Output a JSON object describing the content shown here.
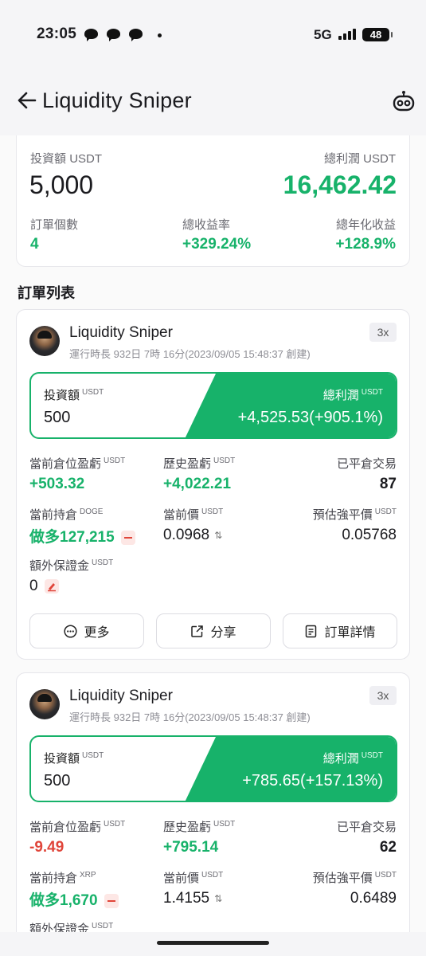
{
  "status_bar": {
    "time": "23:05",
    "network": "5G",
    "battery": "48"
  },
  "header": {
    "title": "Liquidity Sniper"
  },
  "summary": {
    "investment_label": "投資額",
    "investment_unit": "USDT",
    "investment_value": "5,000",
    "profit_label": "總利潤",
    "profit_unit": "USDT",
    "profit_value": "16,462.42",
    "orders_label": "訂單個數",
    "orders_value": "4",
    "return_label": "總收益率",
    "return_value": "+329.24%",
    "annual_label": "總年化收益",
    "annual_value": "+128.9%"
  },
  "section_title": "訂單列表",
  "orders": [
    {
      "name": "Liquidity Sniper",
      "runtime": "運行時長 932日 7時 16分(2023/09/05 15:48:37 創建)",
      "leverage": "3x",
      "invest_label": "投資額",
      "unit": "USDT",
      "invest_value": "500",
      "profit_label": "總利潤",
      "profit_value": "+4,525.53(+905.1%)",
      "pos_pnl_label": "當前倉位盈虧",
      "pos_pnl_value": "+503.32",
      "hist_pnl_label": "歷史盈虧",
      "hist_pnl_value": "+4,022.21",
      "closed_label": "已平倉交易",
      "closed_value": "87",
      "holding_label": "當前持倉",
      "holding_asset": "DOGE",
      "holding_value": "做多127,215",
      "price_label": "當前價",
      "price_value": "0.0968",
      "liq_label": "預估強平價",
      "liq_value": "0.05768",
      "margin_label": "額外保證金",
      "margin_value": "0",
      "btn_more": "更多",
      "btn_share": "分享",
      "btn_detail": "訂單詳情"
    },
    {
      "name": "Liquidity Sniper",
      "runtime": "運行時長 932日 7時 16分(2023/09/05 15:48:37 創建)",
      "leverage": "3x",
      "invest_label": "投資額",
      "unit": "USDT",
      "invest_value": "500",
      "profit_label": "總利潤",
      "profit_value": "+785.65(+157.13%)",
      "pos_pnl_label": "當前倉位盈虧",
      "pos_pnl_value": "-9.49",
      "hist_pnl_label": "歷史盈虧",
      "hist_pnl_value": "+795.14",
      "closed_label": "已平倉交易",
      "closed_value": "62",
      "holding_label": "當前持倉",
      "holding_asset": "XRP",
      "holding_value": "做多1,670",
      "price_label": "當前價",
      "price_value": "1.4155",
      "liq_label": "預估強平價",
      "liq_value": "0.6489",
      "margin_label": "額外保證金"
    }
  ],
  "colors": {
    "green": "#17b26a",
    "red": "#e0453a"
  }
}
